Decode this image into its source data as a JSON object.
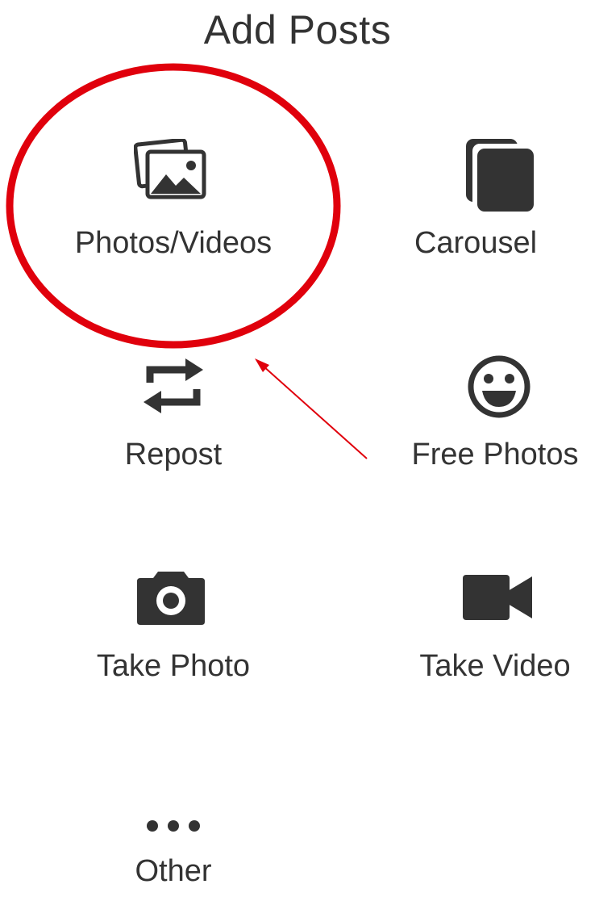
{
  "header": {
    "title": "Add Posts"
  },
  "options": [
    {
      "label": "Photos/Videos",
      "icon": "photos-videos-icon"
    },
    {
      "label": "Carousel",
      "icon": "carousel-icon"
    },
    {
      "label": "Repost",
      "icon": "repost-icon"
    },
    {
      "label": "Free Photos",
      "icon": "smiley-face-icon"
    },
    {
      "label": "Take Photo",
      "icon": "camera-icon"
    },
    {
      "label": "Take Video",
      "icon": "video-camera-icon"
    },
    {
      "label": "Other",
      "icon": "more-dots-icon"
    }
  ],
  "colors": {
    "text": "#333333",
    "icon": "#333333",
    "annotation": "#e0000c",
    "background": "#ffffff"
  }
}
